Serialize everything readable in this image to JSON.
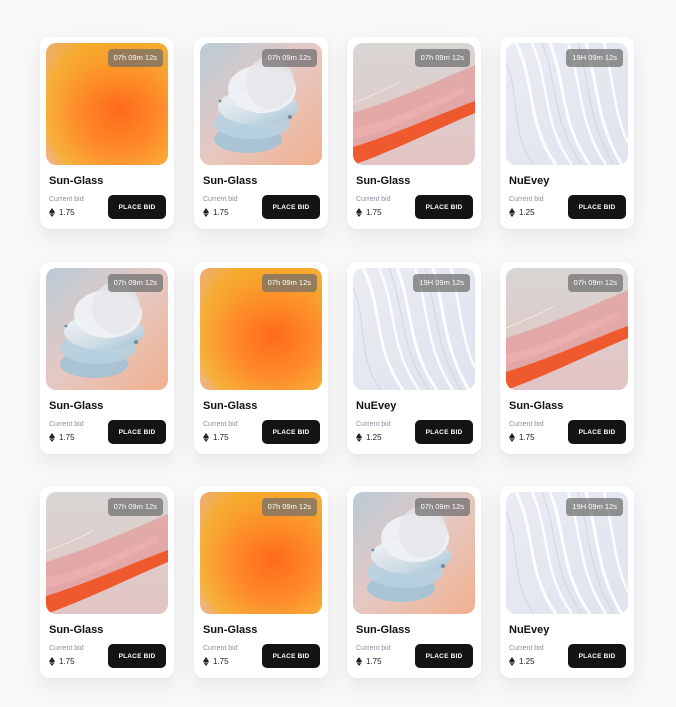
{
  "colors": {
    "button_bg": "#141414",
    "timer_bg": "#6e6e6e",
    "label_gray": "#8a8fa0",
    "card_bg": "#ffffff"
  },
  "cards": [
    {
      "art": "orange-gradient",
      "timer": "07h 09m 12s",
      "title": "Sun-Glass",
      "bid_label": "Current bid",
      "price": "1.75",
      "button": "PLACE BID"
    },
    {
      "art": "glass-discs",
      "timer": "07h 09m 12s",
      "title": "Sun-Glass",
      "bid_label": "Current bid",
      "price": "1.75",
      "button": "PLACE BID"
    },
    {
      "art": "paint-stroke",
      "timer": "07h 09m 12s",
      "title": "Sun-Glass",
      "bid_label": "Current bid",
      "price": "1.75",
      "button": "PLACE BID"
    },
    {
      "art": "white-waves",
      "timer": "19H 09m 12s",
      "title": "NuEvey",
      "bid_label": "Current bid",
      "price": "1.25",
      "button": "PLACE BID"
    },
    {
      "art": "glass-discs",
      "timer": "07h 09m 12s",
      "title": "Sun-Glass",
      "bid_label": "Current bid",
      "price": "1.75",
      "button": "PLACE BID"
    },
    {
      "art": "orange-gradient",
      "timer": "07h 09m 12s",
      "title": "Sun-Glass",
      "bid_label": "Current bid",
      "price": "1.75",
      "button": "PLACE BID"
    },
    {
      "art": "white-waves",
      "timer": "19H 09m 12s",
      "title": "NuEvey",
      "bid_label": "Current bid",
      "price": "1.25",
      "button": "PLACE BID"
    },
    {
      "art": "paint-stroke",
      "timer": "07h 09m 12s",
      "title": "Sun-Glass",
      "bid_label": "Current bid",
      "price": "1.75",
      "button": "PLACE BID"
    },
    {
      "art": "paint-stroke",
      "timer": "07h 09m 12s",
      "title": "Sun-Glass",
      "bid_label": "Current bid",
      "price": "1.75",
      "button": "PLACE BID"
    },
    {
      "art": "orange-gradient",
      "timer": "07h 09m 12s",
      "title": "Sun-Glass",
      "bid_label": "Current bid",
      "price": "1.75",
      "button": "PLACE BID"
    },
    {
      "art": "glass-discs",
      "timer": "07h 09m 12s",
      "title": "Sun-Glass",
      "bid_label": "Current bid",
      "price": "1.75",
      "button": "PLACE BID"
    },
    {
      "art": "white-waves",
      "timer": "19H 09m 12s",
      "title": "NuEvey",
      "bid_label": "Current bid",
      "price": "1.25",
      "button": "PLACE BID"
    }
  ]
}
